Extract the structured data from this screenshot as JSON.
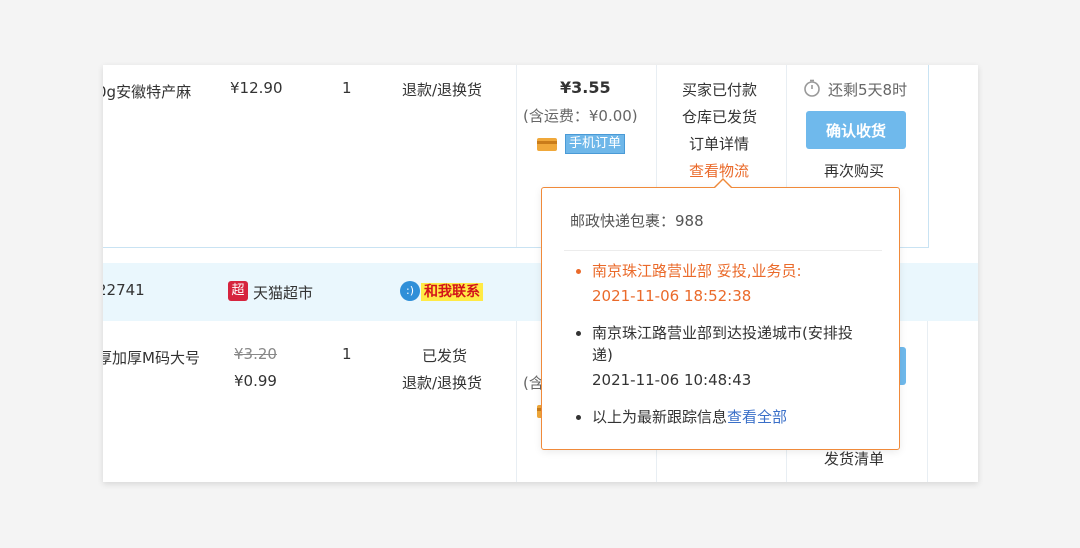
{
  "colors": {
    "accent": "#6fb9ec",
    "orange": "#ea6a2a",
    "popup_border": "#f08a3a",
    "shop_band": "#eaf7fd"
  },
  "order1": {
    "product_name": "0g安徽特产麻",
    "unit_price": "¥12.90",
    "quantity": "1",
    "aftersale": "退款/退换货",
    "total": "¥3.55",
    "shipping": "(含运费：¥0.00)",
    "payment_icon": "card-icon",
    "mobile_badge": "手机订单",
    "status_lines": [
      "买家已付款",
      "仓库已发货",
      "订单详情",
      "查看物流"
    ],
    "countdown": "还剩5天8时",
    "confirm_button": "确认收货",
    "rebuy": "再次购买"
  },
  "shop_row": {
    "order_no": "22741",
    "shop_logo": "超",
    "shop_name": "天猫超市",
    "contact_label": "和我联系",
    "contact_icon": "chat-bubble-icon"
  },
  "order2": {
    "product_name": "厚加厚M码大号",
    "original_price": "¥3.20",
    "price": "¥0.99",
    "quantity": "1",
    "status": "已发货",
    "aftersale": "退款/退换货",
    "shipping_partial": "(含",
    "delivery_list": "发货清单"
  },
  "logistics_popup": {
    "header": "邮政快递包裹：988",
    "tracks": [
      {
        "text": "南京珠江路营业部 妥投,业务员:",
        "time": "2021-11-06 18:52:38"
      },
      {
        "text_line1": "南京珠江路营业部到达投递城市(安排投",
        "text_line2": "递)",
        "time": "2021-11-06 10:48:43"
      }
    ],
    "footer_text": "以上为最新跟踪信息",
    "footer_link": "查看全部"
  }
}
